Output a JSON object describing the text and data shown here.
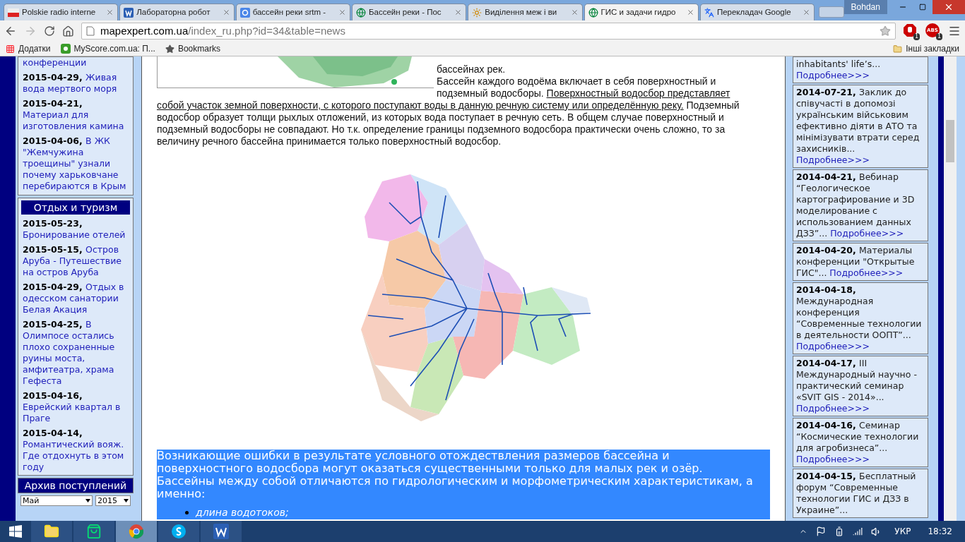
{
  "browser": {
    "tabs": [
      {
        "title": "Polskie radio interne",
        "kind": "flag",
        "selected": false
      },
      {
        "title": "Лабораторна робот",
        "kind": "word",
        "selected": false
      },
      {
        "title": "бассейн реки srtm -",
        "kind": "google",
        "selected": false
      },
      {
        "title": "Бассейн реки - Пос",
        "kind": "globe",
        "selected": false
      },
      {
        "title": "Виділення меж і ви",
        "kind": "sun",
        "selected": false
      },
      {
        "title": "ГИС и задачи гидро",
        "kind": "globe",
        "selected": true
      },
      {
        "title": "Перекладач Google",
        "kind": "translate",
        "selected": false
      }
    ],
    "profile": "Bohdan",
    "url": {
      "host": "mapexpert.com.ua",
      "path": "/index_ru.php?id=34&table=news"
    },
    "extensions": [
      {
        "kind": "stop",
        "badge": "1"
      },
      {
        "kind": "abs",
        "label": "ABS",
        "badge": "1"
      }
    ],
    "bookmarks": [
      {
        "kind": "apps",
        "label": "Додатки"
      },
      {
        "kind": "site",
        "label": "MyScore.com.ua: П..."
      },
      {
        "kind": "star",
        "label": "Bookmarks"
      }
    ],
    "other_bookmarks": "Інші закладки"
  },
  "left_column": {
    "news": [
      {
        "title": "конференции"
      },
      {
        "date": "2015-04-29,",
        "title": "Живая вода мертвого моря"
      },
      {
        "date": "2015-04-21,",
        "title": "Материал для изготовления камина"
      },
      {
        "date": "2015-04-06,",
        "title": "В ЖК \"Жемчужина троещины\" узнали почему харьковчане перебираются в Крым"
      }
    ],
    "tourism": {
      "title": "Отдых и туризм",
      "items": [
        {
          "date": "2015-05-23,",
          "title": "Бронирование отелей"
        },
        {
          "date": "2015-05-15,",
          "title": "Остров Аруба - Путешествие на остров Аруба"
        },
        {
          "date": "2015-04-29,",
          "title": "Отдых в одесском санатории Белая Акация"
        },
        {
          "date": "2015-04-25,",
          "title": "В Олимпосе остались плохо сохраненные руины моста, амфитеатра, храма Гефеста"
        },
        {
          "date": "2015-04-16,",
          "title": "Еврейский квартал в Праге"
        },
        {
          "date": "2015-04-14,",
          "title": "Романтический вояж. Где отдохнуть в этом году"
        }
      ]
    },
    "archive": {
      "title": "Архив поступлений",
      "month": "Май",
      "year": "2015"
    }
  },
  "article": {
    "intro": "бассейнах рек.",
    "paragraph": [
      {
        "text": "Бассейн каждого водоёма включает в себя поверхностный и подземный водосборы. ",
        "underline": false
      },
      {
        "text": "Поверхностный водосбор представляет собой участок земной поверхности, с которого поступают воды в данную речную систему или определённую реку.",
        "underline": true
      },
      {
        "text": " Подземный водосбор образует толщи рыхлых отложений, из которых вода поступает в речную сеть. В общем случае поверхностный и подземный водосборы не совпадают. Но т.к. определение границы подземного водосбора практически очень сложно, то за величину речного бассейна принимается только поверхностный водосбор.",
        "underline": false
      }
    ],
    "highlight": {
      "paragraphs": [
        "Возникающие ошибки в результате условного отождествления размеров бассейна и поверхностного водосбора могут оказаться существенными только для малых рек и озёр.",
        "Бассейны между собой отличаются по гидрологическим и морфометрическим характеристикам, а именно:"
      ],
      "list": [
        "длина водотоков;"
      ]
    }
  },
  "right_column": {
    "items": [
      {
        "title": "inhabitants' life’s...",
        "more": "Подробнее>>>"
      },
      {
        "date": "2014-07-21,",
        "title": "Заклик до співучасті в допомозі українським військовим ефективно діяти в АТО та мінімізувати втрати серед захисників...",
        "more": "Подробнее>>>"
      },
      {
        "date": "2014-04-21,",
        "title": "Вебинар “Геологическое картографирование и 3D моделирование с использованием данных ДЗЗ”...",
        "more": "Подробнее>>>"
      },
      {
        "date": "2014-04-20,",
        "title": "Материалы конференции \"Открытые ГИС\"...",
        "more": "Подробнее>>>"
      },
      {
        "date": "2014-04-18,",
        "title": "Международная конференция “Современные технологии в деятельности ООПТ”...",
        "more": "Подробнее>>>"
      },
      {
        "date": "2014-04-17,",
        "title": "III Международный научно - практический семинар «SVIT GIS - 2014»...",
        "more": "Подробнее>>>"
      },
      {
        "date": "2014-04-16,",
        "title": "Семинар “Космические технологии для агробизнеса”...",
        "more": "Подробнее>>>"
      },
      {
        "date": "2014-04-15,",
        "title": "Бесплатный форум “Современные технологии ГИС и ДЗЗ в Украине”..."
      }
    ]
  },
  "taskbar": {
    "apps": [
      {
        "kind": "explorer",
        "selected": false
      },
      {
        "kind": "store",
        "selected": false
      },
      {
        "kind": "chrome",
        "selected": true
      },
      {
        "kind": "skype",
        "selected": false
      },
      {
        "kind": "word",
        "selected": false
      }
    ],
    "language": "УКР",
    "time": "18:32"
  }
}
